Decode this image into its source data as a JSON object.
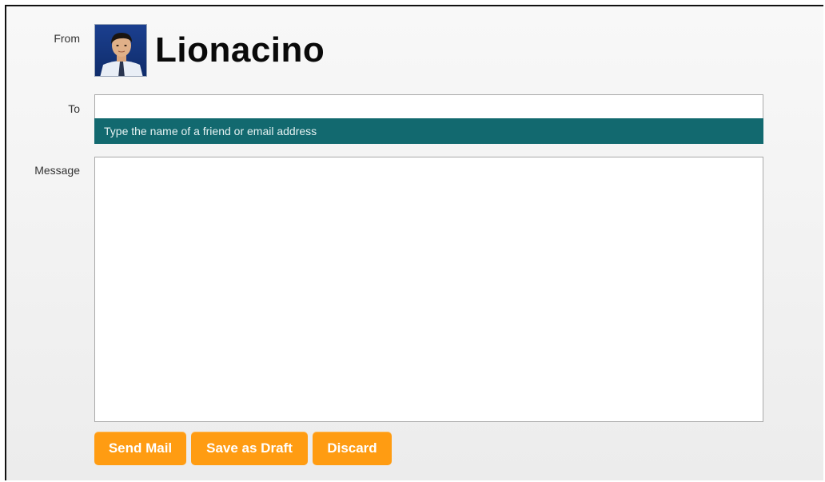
{
  "compose": {
    "from_label": "From",
    "to_label": "To",
    "message_label": "Message",
    "sender": {
      "name": "Lionacino",
      "avatar_icon": "user-photo"
    },
    "to_field": {
      "value": "",
      "hint": "Type the name of a friend or email address"
    },
    "message_field": {
      "value": ""
    },
    "actions": {
      "send_label": "Send Mail",
      "draft_label": "Save as Draft",
      "discard_label": "Discard"
    }
  },
  "colors": {
    "hint_bar": "#12696f",
    "button": "#ff9c12"
  }
}
